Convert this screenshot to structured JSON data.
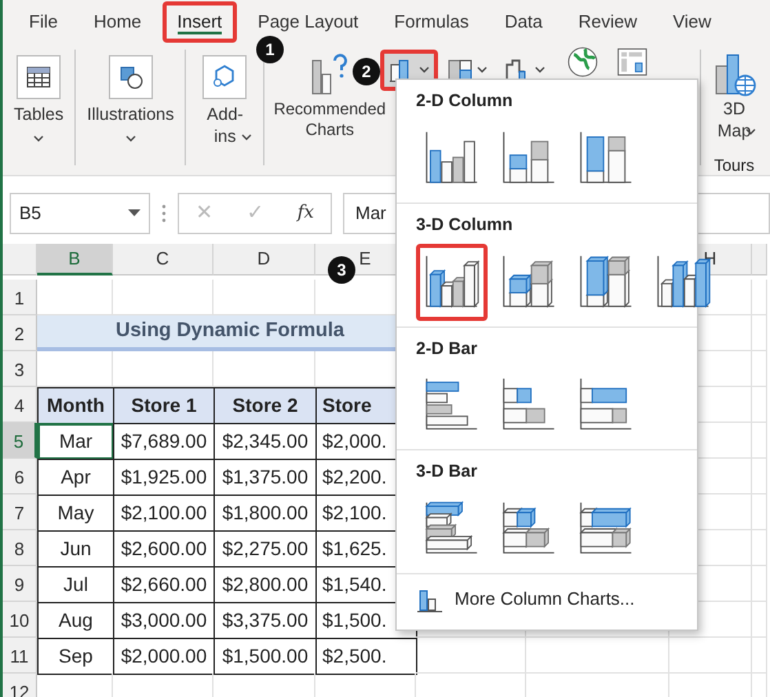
{
  "tabs": [
    {
      "label": "File",
      "selected": false,
      "highlighted": false
    },
    {
      "label": "Home",
      "selected": false,
      "highlighted": false
    },
    {
      "label": "Insert",
      "selected": true,
      "highlighted": true
    },
    {
      "label": "Page Layout",
      "selected": false,
      "highlighted": false
    },
    {
      "label": "Formulas",
      "selected": false,
      "highlighted": false
    },
    {
      "label": "Data",
      "selected": false,
      "highlighted": false
    },
    {
      "label": "Review",
      "selected": false,
      "highlighted": false
    },
    {
      "label": "View",
      "selected": false,
      "highlighted": false
    }
  ],
  "ribbon": [
    {
      "kind": "large",
      "label": "Tables"
    },
    {
      "kind": "large",
      "label": "Illustrations"
    },
    {
      "kind": "large",
      "label": "Add-ins"
    },
    {
      "kind": "large",
      "label": "Recommended Charts"
    },
    {
      "kind": "small",
      "highlighted": true
    },
    {
      "kind": "small",
      "highlighted": false
    },
    {
      "kind": "small",
      "highlighted": false
    },
    {
      "kind": "large"
    },
    {
      "kind": "large"
    },
    {
      "kind": "tour",
      "label": "3D Map",
      "group_label": "Tours"
    }
  ],
  "name_box": "B5",
  "formula_buttons": [
    {
      "label": "✕",
      "disabled": true
    },
    {
      "label": "✓",
      "disabled": true
    },
    {
      "label": "fx",
      "disabled": false
    }
  ],
  "formula": "Mar",
  "columns": [
    {
      "label": "B",
      "selected": true
    },
    {
      "label": "C",
      "selected": false
    },
    {
      "label": "D",
      "selected": false
    },
    {
      "label": "E",
      "selected": false
    },
    {
      "label": "H",
      "selected": false
    }
  ],
  "rows": [
    {
      "label": "1",
      "selected": false,
      "kind": "empty"
    },
    {
      "label": "2",
      "selected": false,
      "kind": "title",
      "text": "Using Dynamic Formula"
    },
    {
      "label": "3",
      "selected": false,
      "kind": "empty"
    },
    {
      "label": "4",
      "selected": false,
      "kind": "header",
      "cells": [
        "Month",
        "Store 1",
        "Store 2",
        "Store"
      ]
    },
    {
      "label": "5",
      "selected": true,
      "kind": "data",
      "cells": [
        "Mar",
        "$7,689.00",
        "$2,345.00",
        "$2,000."
      ]
    },
    {
      "label": "6",
      "selected": false,
      "kind": "data",
      "cells": [
        "Apr",
        "$1,925.00",
        "$1,375.00",
        "$2,200."
      ]
    },
    {
      "label": "7",
      "selected": false,
      "kind": "data",
      "cells": [
        "May",
        "$2,100.00",
        "$1,800.00",
        "$2,100."
      ]
    },
    {
      "label": "8",
      "selected": false,
      "kind": "data",
      "cells": [
        "Jun",
        "$2,600.00",
        "$2,275.00",
        "$1,625."
      ]
    },
    {
      "label": "9",
      "selected": false,
      "kind": "data",
      "cells": [
        "Jul",
        "$2,660.00",
        "$2,800.00",
        "$1,540."
      ]
    },
    {
      "label": "10",
      "selected": false,
      "kind": "data",
      "cells": [
        "Aug",
        "$3,000.00",
        "$3,375.00",
        "$1,500."
      ]
    },
    {
      "label": "11",
      "selected": false,
      "kind": "data",
      "cells": [
        "Sep",
        "$2,000.00",
        "$1,500.00",
        "$2,500."
      ]
    },
    {
      "label": "12",
      "selected": false,
      "kind": "empty"
    }
  ],
  "menu": {
    "sections": [
      {
        "title": "2-D Column",
        "items": [
          {
            "kind": "clustered",
            "selected": false
          },
          {
            "kind": "stacked",
            "selected": false
          },
          {
            "kind": "stacked100",
            "selected": false
          }
        ]
      },
      {
        "title": "3-D Column",
        "items": [
          {
            "kind": "clustered",
            "selected": true
          },
          {
            "kind": "stacked",
            "selected": false
          },
          {
            "kind": "stacked100",
            "selected": false
          },
          {
            "kind": "deep",
            "selected": false
          }
        ]
      },
      {
        "title": "2-D Bar",
        "items": [
          {
            "kind": "clustered",
            "selected": false
          },
          {
            "kind": "stacked",
            "selected": false
          },
          {
            "kind": "stacked100",
            "selected": false
          }
        ]
      },
      {
        "title": "3-D Bar",
        "items": [
          {
            "kind": "clustered",
            "selected": false
          },
          {
            "kind": "stacked",
            "selected": false
          },
          {
            "kind": "stacked100",
            "selected": false
          }
        ]
      }
    ],
    "footer": "More Column Charts..."
  },
  "callouts": [
    {
      "label": "1"
    },
    {
      "label": "2"
    },
    {
      "label": "3"
    }
  ]
}
